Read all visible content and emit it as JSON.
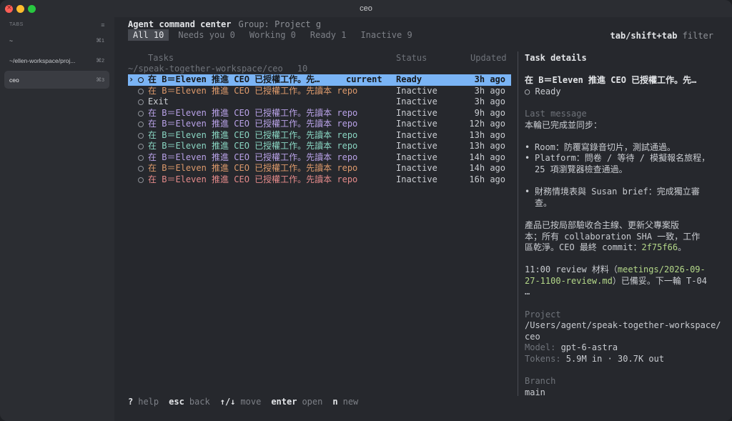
{
  "window": {
    "title": "ceo"
  },
  "sidebar": {
    "heading": "TABS",
    "items": [
      {
        "label": "~",
        "shortcut": "⌘1"
      },
      {
        "label": "~/ellen-workspace/proj...",
        "shortcut": "⌘2"
      },
      {
        "label": "ceo",
        "shortcut": "⌘3"
      }
    ]
  },
  "header": {
    "title": "Agent command center",
    "group": "Group: Project  g",
    "filters": [
      "All 10",
      "Needs you 0",
      "Working 0",
      "Ready 1",
      "Inactive 9"
    ],
    "hint_key": "tab/shift+tab",
    "hint_text": " filter"
  },
  "columns": {
    "tasks": "Tasks",
    "status": "Status",
    "updated": "Updated"
  },
  "project": {
    "path": "~/speak-together-workspace/ceo",
    "count": "10"
  },
  "rows": [
    {
      "caret": "›",
      "text": "在 B＝Eleven 推進 CEO 已授權工作。先…",
      "tag": "current",
      "status": "Ready",
      "updated": "3h ago",
      "color": "#dd9a6c"
    },
    {
      "caret": "",
      "text": "在 B＝Eleven 推進 CEO 已授權工作。先讀本 repo A…",
      "tag": "",
      "status": "Inactive",
      "updated": "3h ago",
      "color": "#dd9a6c"
    },
    {
      "caret": "",
      "text": "Exit",
      "tag": "",
      "status": "Inactive",
      "updated": "3h ago",
      "color": "#c9ccd1"
    },
    {
      "caret": "",
      "text": "在 B＝Eleven 推進 CEO 已授權工作。先讀本 repo A…",
      "tag": "",
      "status": "Inactive",
      "updated": "9h ago",
      "color": "#b9a2e8"
    },
    {
      "caret": "",
      "text": "在 B＝Eleven 推進 CEO 已授權工作。先讀本 repo A…",
      "tag": "",
      "status": "Inactive",
      "updated": "12h ago",
      "color": "#b9a2e8"
    },
    {
      "caret": "",
      "text": "在 B＝Eleven 推進 CEO 已授權工作。先讀本 repo A…",
      "tag": "",
      "status": "Inactive",
      "updated": "13h ago",
      "color": "#8ad6c3"
    },
    {
      "caret": "",
      "text": "在 B＝Eleven 推進 CEO 已授權工作。先讀本 repo A…",
      "tag": "",
      "status": "Inactive",
      "updated": "13h ago",
      "color": "#8ad6c3"
    },
    {
      "caret": "",
      "text": "在 B＝Eleven 推進 CEO 已授權工作。先讀本 repo A…",
      "tag": "",
      "status": "Inactive",
      "updated": "14h ago",
      "color": "#b9a2e8"
    },
    {
      "caret": "",
      "text": "在 B＝Eleven 推進 CEO 已授權工作。先讀本 repo A…",
      "tag": "",
      "status": "Inactive",
      "updated": "14h ago",
      "color": "#dd9a6c"
    },
    {
      "caret": "",
      "text": "在 B＝Eleven 推進 CEO 已授權工作。先讀本 repo A…",
      "tag": "",
      "status": "Inactive",
      "updated": "16h ago",
      "color": "#e48a8a"
    }
  ],
  "details": {
    "heading": "Task details",
    "task_title": "在 B＝Eleven 推進 CEO 已授權工作。先…",
    "task_status": "Ready",
    "last_message_label": "Last message",
    "msg_intro": "本輪已完成並同步：",
    "bullet1": "Room：防覆寫錄音切片，測試通過。",
    "bullet2a": "Platform：問卷 / 等待 / 模擬報名旅程，",
    "bullet2b": "25 項瀏覽器檢查通過。",
    "bullet3a": "財務情境表與 Susan brief：完成獨立審",
    "bullet3b": "查。",
    "para1a": "產品已按局部驗收合主線、更新父專案版",
    "para1b": "本；所有 collaboration SHA 一致，工作",
    "para1c": "區乾淨。CEO 最終 commit：",
    "commit": "2f75f66",
    "para1d": "。",
    "para2a": "11:00 review 材料（",
    "meeting_a": "meetings/2026-09-",
    "meeting_b": "27-1100-review.md",
    "para2b": "）已備妥。下一輪 T-04",
    "ellipsis": "…",
    "project_label": "Project",
    "project_path_a": "/Users/agent/speak-together-workspace/",
    "project_path_b": "ceo",
    "model_label": "Model: ",
    "model": "gpt-6-astra",
    "tokens_label": "Tokens: ",
    "tokens": "5.9M in · 30.7K out",
    "branch_label": "Branch",
    "branch": "main"
  },
  "footer": [
    {
      "key": "?",
      "label": "help"
    },
    {
      "key": "esc",
      "label": "back"
    },
    {
      "key": "↑/↓",
      "label": "move"
    },
    {
      "key": "enter",
      "label": "open"
    },
    {
      "key": "n",
      "label": "new"
    }
  ]
}
